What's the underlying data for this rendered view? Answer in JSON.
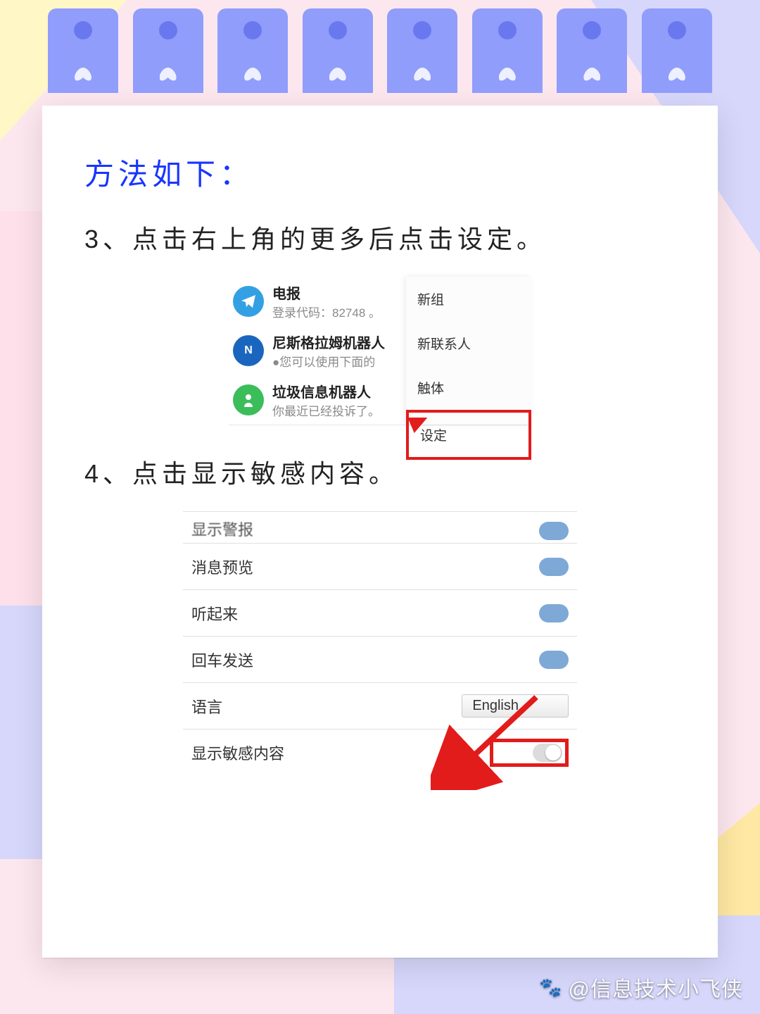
{
  "title": "方法如下：",
  "step3": "3、点击右上角的更多后点击设定。",
  "step4": "4、点击显示敏感内容。",
  "shot1": {
    "chat1_name": "电报",
    "chat1_sub": "登录代码：82748 。",
    "chat2_name": "尼斯格拉姆机器人",
    "chat2_sub": "●您可以使用下面的",
    "chat3_name": "垃圾信息机器人",
    "chat3_sub": "你最近已经投诉了。",
    "menu": {
      "m1": "新组",
      "m2": "新联系人",
      "m3": "触体",
      "m4": "设定"
    }
  },
  "shot2": {
    "row0": "显示警报",
    "row1": "消息预览",
    "row2": "听起来",
    "row3": "回车发送",
    "row4": "语言",
    "row4_value": "English",
    "row5": "显示敏感内容"
  },
  "watermark": "@信息技术小飞侠"
}
